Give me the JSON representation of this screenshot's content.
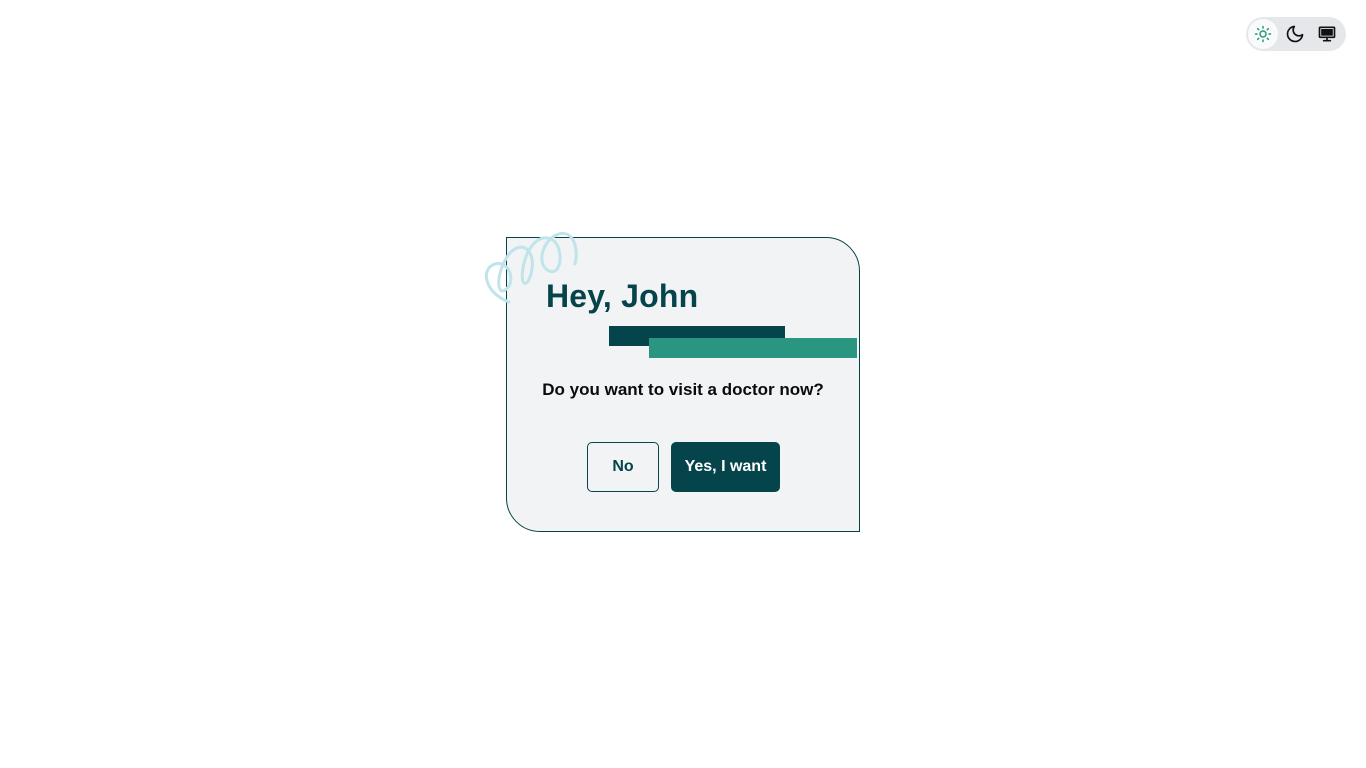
{
  "theme_switcher": {
    "options": [
      {
        "icon": "sun-icon",
        "label": "Light",
        "active": true
      },
      {
        "icon": "moon-icon",
        "label": "Dark",
        "active": false
      },
      {
        "icon": "monitor-icon",
        "label": "System",
        "active": false
      }
    ]
  },
  "dialog": {
    "title": "Hey, John",
    "question": "Do you want to visit a doctor now?",
    "no_label": "No",
    "yes_label": "Yes, I want"
  },
  "colors": {
    "primary_dark": "#06444c",
    "accent_teal": "#2a9580",
    "card_bg": "#f1f3f4",
    "active_icon": "#2a9580"
  }
}
